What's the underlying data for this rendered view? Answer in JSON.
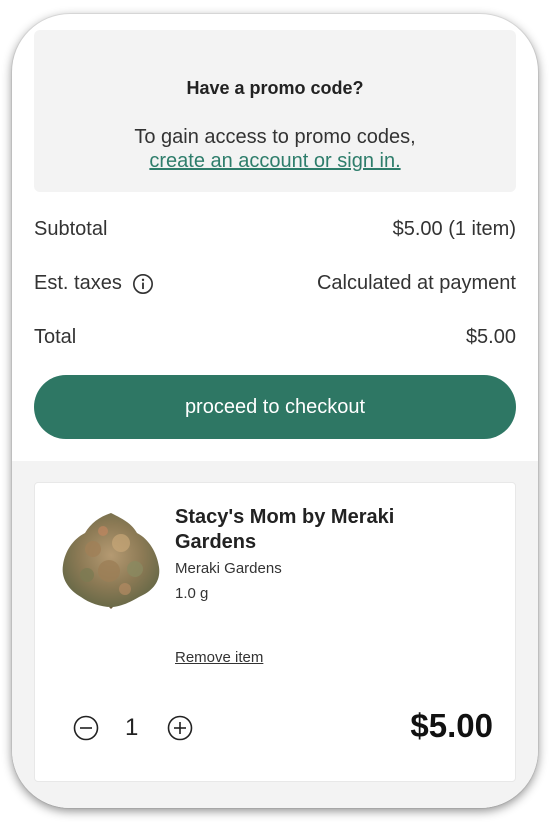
{
  "promo": {
    "title": "Have a promo code?",
    "text": "To gain access to promo codes,",
    "link": "create an account or sign in."
  },
  "summary": {
    "subtotal_label": "Subtotal",
    "subtotal_value": "$5.00 (1 item)",
    "taxes_label": "Est. taxes",
    "taxes_value": "Calculated at payment",
    "total_label": "Total",
    "total_value": "$5.00"
  },
  "checkout": {
    "label": "proceed to checkout"
  },
  "cart_item": {
    "name": "Stacy's Mom by Meraki Gardens",
    "brand": "Meraki Gardens",
    "weight": "1.0 g",
    "remove_label": "Remove item",
    "quantity": "1",
    "price": "$5.00"
  },
  "icons": {
    "info": "info-icon",
    "minus": "minus-circle-icon",
    "plus": "plus-circle-icon"
  },
  "colors": {
    "accent": "#2e7764",
    "link": "#2e7d6b",
    "panel": "#f3f3f3"
  }
}
